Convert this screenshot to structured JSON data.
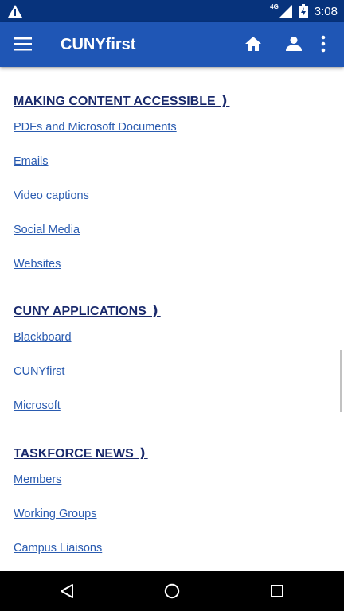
{
  "status_bar": {
    "network": "4G",
    "time": "3:08"
  },
  "app_bar": {
    "title": "CUNYfirst"
  },
  "sections": [
    {
      "title": "MAKING CONTENT ACCESSIBLE ❫",
      "links": [
        "PDFs and Microsoft Documents",
        "Emails",
        "Video captions",
        "Social Media",
        "Websites"
      ]
    },
    {
      "title": "CUNY APPLICATIONS ❫",
      "links": [
        "Blackboard",
        "CUNYfirst",
        "Microsoft"
      ]
    },
    {
      "title": "TASKFORCE NEWS ❫",
      "links": [
        "Members",
        "Working Groups",
        "Campus Liaisons"
      ]
    }
  ],
  "colors": {
    "status_bar_bg": "#07337c",
    "app_bar_bg": "#1f56b5",
    "section_title": "#1a2a6c",
    "link": "#2a5bb0",
    "nav_bar_bg": "#000000"
  },
  "icons": {
    "status_left": "warning-icon",
    "menu": "hamburger-menu-icon",
    "home": "home-icon",
    "account": "person-icon",
    "more": "more-vertical-icon",
    "nav_back": "back-triangle-icon",
    "nav_home": "home-circle-icon",
    "nav_recents": "recents-square-icon"
  }
}
